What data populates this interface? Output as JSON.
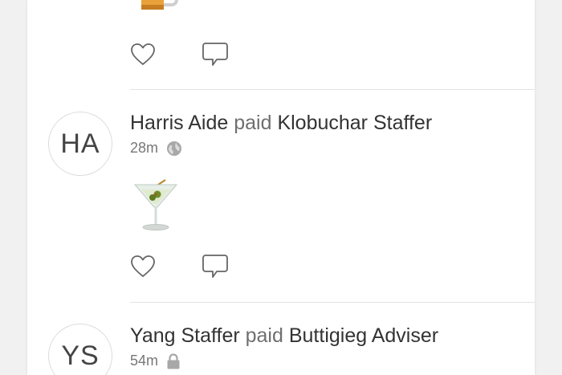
{
  "feed": {
    "items": [
      {
        "emoji": "beer-mug",
        "actions": {
          "like_icon": "heart-outline-icon",
          "comment_icon": "speech-bubble-icon"
        }
      },
      {
        "avatar_initials": "HA",
        "actor": "Harris Aide",
        "verb": "paid",
        "target": "Klobuchar Staffer",
        "time": "28m",
        "privacy_icon": "globe-icon",
        "emoji": "martini-glass",
        "actions": {
          "like_icon": "heart-outline-icon",
          "comment_icon": "speech-bubble-icon"
        }
      },
      {
        "avatar_initials": "YS",
        "actor": "Yang Staffer",
        "verb": "paid",
        "target": "Buttigieg Adviser",
        "time": "54m",
        "privacy_icon": "lock-icon"
      }
    ]
  },
  "colors": {
    "background": "#f1f1f1",
    "card": "#ffffff",
    "text_primary": "#333333",
    "text_secondary": "#6f6f6f",
    "icon": "#666666",
    "divider": "#e3e3e3"
  }
}
